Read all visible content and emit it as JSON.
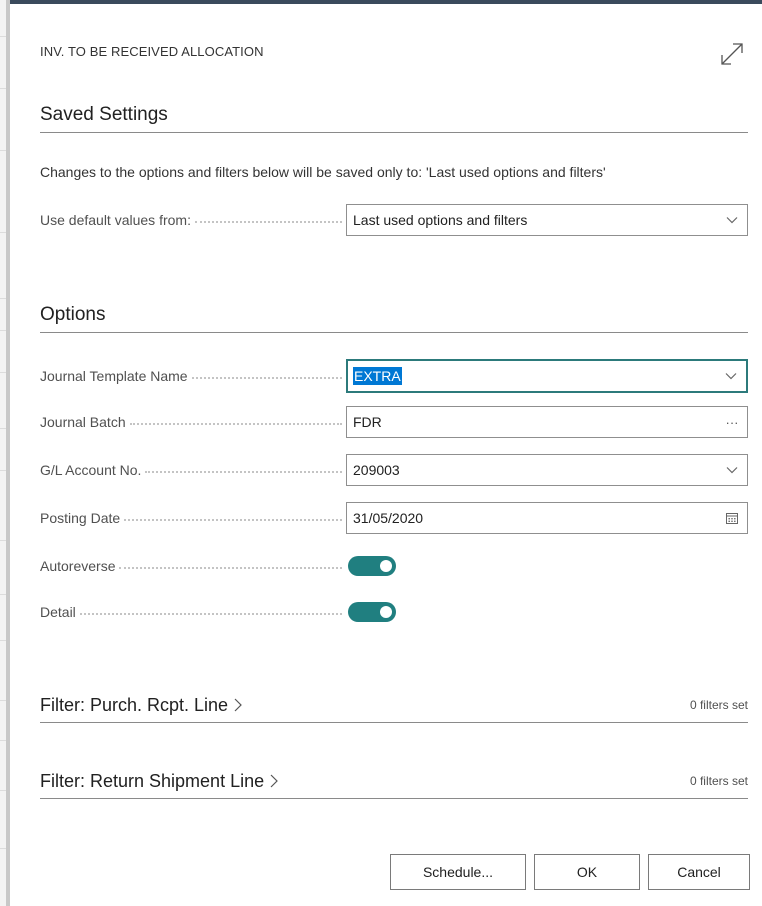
{
  "dialog": {
    "title": "INV. TO BE RECEIVED ALLOCATION"
  },
  "saved_settings": {
    "title": "Saved Settings",
    "info": "Changes to the options and filters below will be saved only to: 'Last used options and filters'",
    "use_default_label": "Use default values from:",
    "use_default_value": "Last used options and filters"
  },
  "options": {
    "title": "Options",
    "journal_template_label": "Journal Template Name",
    "journal_template_value": "EXTRA",
    "journal_batch_label": "Journal Batch",
    "journal_batch_value": "FDR",
    "journal_batch_button": "···",
    "gl_account_label": "G/L Account No.",
    "gl_account_value": "209003",
    "posting_date_label": "Posting Date",
    "posting_date_value": "31/05/2020",
    "autoreverse_label": "Autoreverse",
    "autoreverse_on": true,
    "detail_label": "Detail",
    "detail_on": true
  },
  "filters": [
    {
      "title": "Filter: Purch. Rcpt. Line",
      "count": "0 filters set"
    },
    {
      "title": "Filter: Return Shipment Line",
      "count": "0 filters set"
    }
  ],
  "buttons": {
    "schedule": "Schedule...",
    "ok": "OK",
    "cancel": "Cancel"
  },
  "colors": {
    "accent": "#207f80",
    "selection": "#0078d4"
  }
}
